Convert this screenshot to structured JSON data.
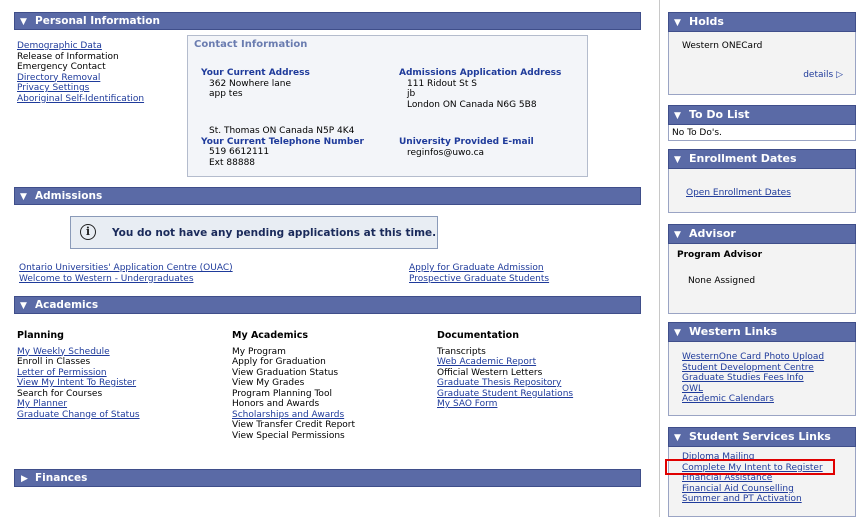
{
  "personal": {
    "title": "Personal Information",
    "links": [
      {
        "label": "Demographic Data",
        "link": true
      },
      {
        "label": "Release of Information",
        "link": false
      },
      {
        "label": "Emergency Contact",
        "link": false
      },
      {
        "label": "Directory Removal",
        "link": true
      },
      {
        "label": "Privacy Settings",
        "link": true
      },
      {
        "label": "Aboriginal Self-Identification",
        "link": true
      }
    ],
    "contact": {
      "title": "Contact Information",
      "current_address_label": "Your Current Address",
      "current_address": [
        "362 Nowhere lane",
        "app tes"
      ],
      "current_city": "St. Thomas ON Canada N5P 4K4",
      "phone_label": "Your Current Telephone Number",
      "phone": [
        "519 6612111",
        "Ext 88888"
      ],
      "admissions_label": "Admissions Application Address",
      "admissions_address": [
        "111 Ridout St S",
        "jb",
        "London ON Canada N6G 5B8"
      ],
      "email_label": "University Provided E-mail",
      "email": "reginfos@uwo.ca"
    }
  },
  "admissions": {
    "title": "Admissions",
    "notice": "You do not have any pending applications at this time.",
    "links_left": [
      "Ontario Universities' Application Centre (OUAC)",
      "Welcome to Western - Undergraduates"
    ],
    "links_right": [
      "Apply for Graduate Admission",
      "Prospective Graduate Students"
    ]
  },
  "academics": {
    "title": "Academics",
    "columns": [
      {
        "heading": "Planning",
        "items": [
          {
            "label": "My Weekly Schedule",
            "link": true
          },
          {
            "label": "Enroll in Classes",
            "link": false
          },
          {
            "label": "Letter of Permission",
            "link": true
          },
          {
            "label": "View My Intent To Register",
            "link": true
          },
          {
            "label": "Search for Courses",
            "link": false
          },
          {
            "label": "My Planner",
            "link": true
          },
          {
            "label": "Graduate Change of Status",
            "link": true
          }
        ]
      },
      {
        "heading": "My Academics",
        "items": [
          {
            "label": "My Program",
            "link": false
          },
          {
            "label": "Apply for Graduation",
            "link": false
          },
          {
            "label": "View Graduation Status",
            "link": false
          },
          {
            "label": "View My Grades",
            "link": false
          },
          {
            "label": "Program Planning Tool",
            "link": false
          },
          {
            "label": "Honors and Awards",
            "link": false
          },
          {
            "label": "Scholarships and Awards",
            "link": true
          },
          {
            "label": "View Transfer Credit Report",
            "link": false
          },
          {
            "label": "View Special Permissions",
            "link": false
          }
        ]
      },
      {
        "heading": "Documentation",
        "items": [
          {
            "label": "Transcripts",
            "link": false
          },
          {
            "label": "Web Academic Report",
            "link": true
          },
          {
            "label": "Official Western Letters",
            "link": false
          },
          {
            "label": "Graduate Thesis Repository",
            "link": true
          },
          {
            "label": "Graduate Student Regulations",
            "link": true
          },
          {
            "label": "My SAO Form",
            "link": true
          }
        ]
      }
    ]
  },
  "finances": {
    "title": "Finances"
  },
  "sidebar": {
    "holds": {
      "title": "Holds",
      "item": "Western ONECard",
      "details": "details"
    },
    "todo": {
      "title": "To Do List",
      "text": "No To Do's."
    },
    "enrollment": {
      "title": "Enrollment Dates",
      "link": "Open Enrollment Dates"
    },
    "advisor": {
      "title": "Advisor",
      "label": "Program Advisor",
      "value": "None Assigned"
    },
    "western_links": {
      "title": "Western Links",
      "links": [
        "WesternOne Card Photo Upload",
        "Student Development Centre",
        "Graduate Studies Fees Info",
        "OWL",
        "Academic Calendars"
      ]
    },
    "student_services": {
      "title": "Student Services Links",
      "links": [
        "Diploma Mailing",
        "Complete My Intent to Register",
        "Financial Assistance",
        "Financial Aid Counselling",
        "Summer and PT Activation"
      ]
    }
  }
}
